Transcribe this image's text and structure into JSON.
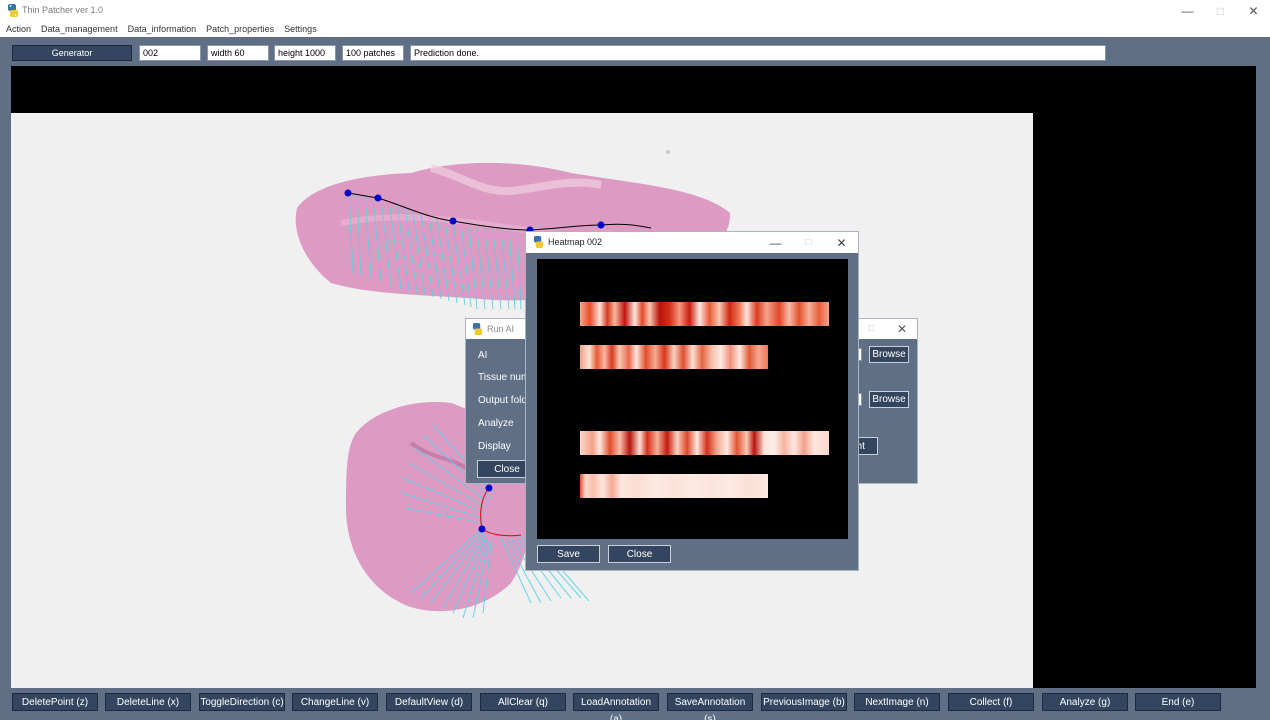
{
  "window": {
    "title": "Thin Patcher ver 1.0",
    "icon": "python-icon",
    "controls": [
      "minimize-icon",
      "maximize-icon",
      "close-icon"
    ]
  },
  "menu": [
    "Action",
    "Data_management",
    "Data_information",
    "Patch_properties",
    "Settings"
  ],
  "toolbar": {
    "generator_label": "Generator",
    "slide_id": "002",
    "width": "width 60",
    "height": "height 1000",
    "patches": "100 patches",
    "status": "Prediction done."
  },
  "bottom_buttons": [
    "DeletePoint (z)",
    "DeleteLine (x)",
    "ToggleDirection (c)",
    "ChangeLine (v)",
    "DefaultView (d)",
    "AllClear (q)",
    "LoadAnnotation (a)",
    "SaveAnnotation (s)",
    "PreviousImage (b)",
    "NextImage (n)",
    "Collect (f)",
    "Analyze (g)",
    "End (e)"
  ],
  "run_ai_dialog": {
    "title": "Run AI",
    "labels": [
      "AI",
      "Tissue num",
      "Output folde",
      "Analyze",
      "Display"
    ],
    "browse_label": "Browse",
    "close_label": "Close",
    "partial_button": "ght"
  },
  "heatmap_dialog": {
    "title": "Heatmap 002",
    "save_label": "Save",
    "close_label": "Close",
    "colors": {
      "low": "#fbe6e0",
      "mid": "#f08060",
      "high": "#b8140c"
    }
  },
  "colors": {
    "frame": "#5f6f86",
    "button": "#34465f",
    "annotation_point": "#0000cc",
    "patch_lines": "#5ad0e8",
    "tissue": "#d98cbc"
  }
}
